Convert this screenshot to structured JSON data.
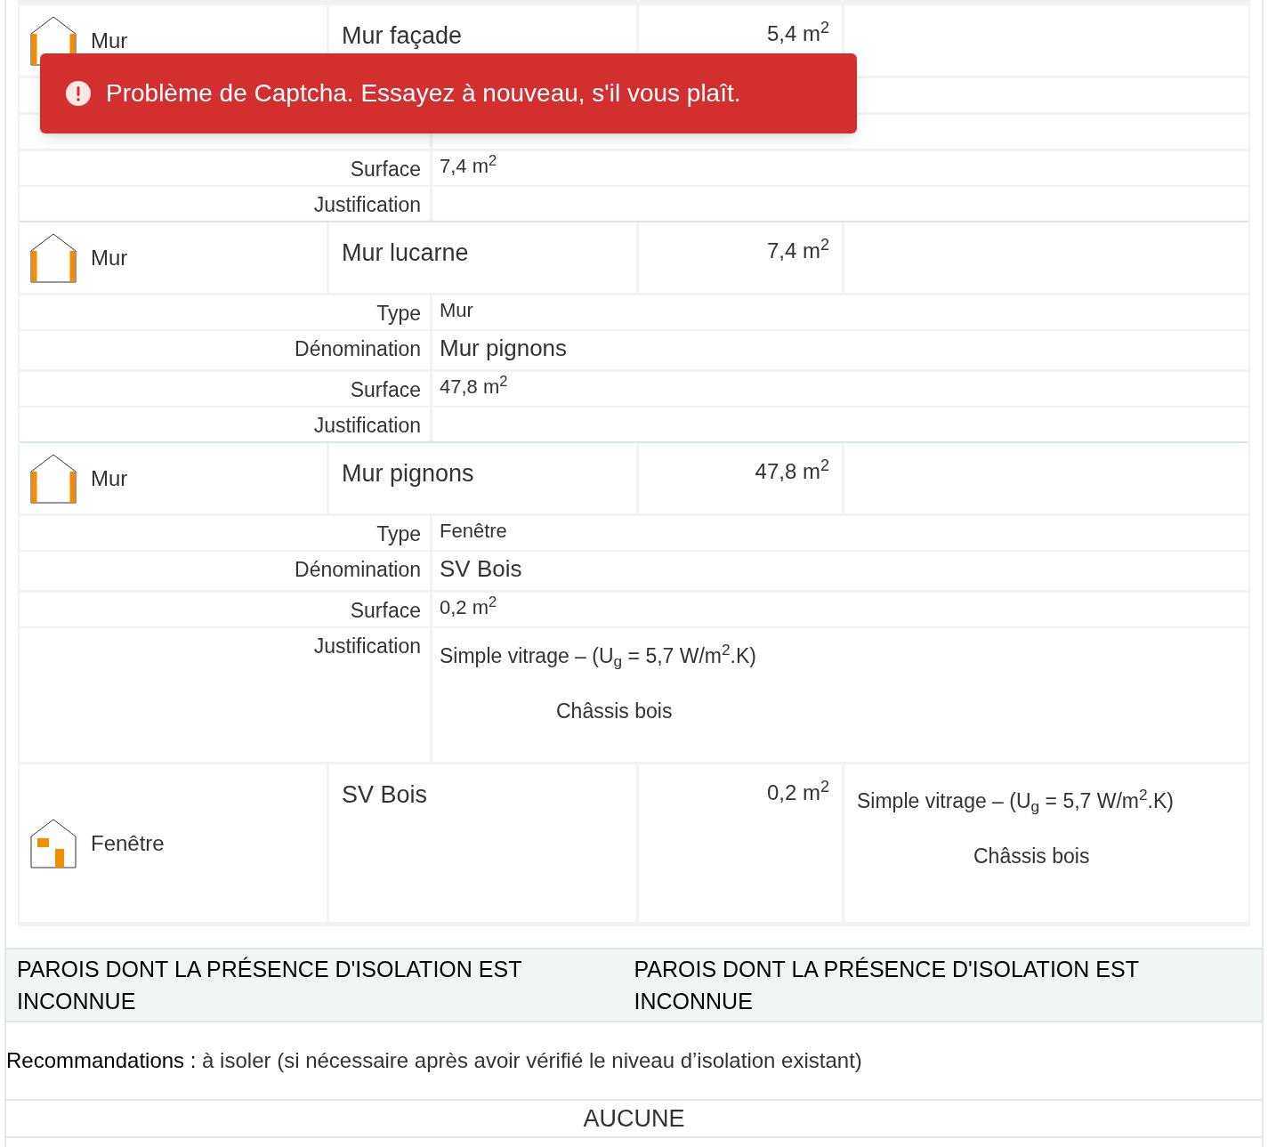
{
  "toast": {
    "message": "Problème de Captcha. Essayez à nouveau, s'il vous plaît."
  },
  "rows": [
    {
      "kind": "wall",
      "type": "Mur",
      "name": "Mur façade",
      "surface": "5,4 m$^{2}$"
    },
    {
      "kind": "blank"
    },
    {
      "kind": "blank"
    },
    {
      "kind": "detail",
      "label": "Surface",
      "value": "7,4 m$^{2}$"
    },
    {
      "kind": "end",
      "label": "Justification"
    },
    {
      "kind": "wall",
      "type": "Mur",
      "name": "Mur lucarne",
      "surface": "7,4 m$^{2}$"
    },
    {
      "kind": "detail",
      "label": "Type",
      "value": "Mur"
    },
    {
      "kind": "name",
      "label": "Dénomination",
      "value": "Mur pignons"
    },
    {
      "kind": "detail",
      "label": "Surface",
      "value": "47,8 m$^{2}$"
    },
    {
      "kind": "end",
      "label": "Justification"
    },
    {
      "kind": "wall",
      "type": "Mur",
      "name": "Mur pignons",
      "surface": "47,8 m$^{2}$"
    },
    {
      "kind": "detail",
      "label": "Type",
      "value": "Fenêtre"
    },
    {
      "kind": "name",
      "label": "Dénomination",
      "value": "SV Bois"
    },
    {
      "kind": "detail",
      "label": "Surface",
      "value": "0,2 m$^{2}$"
    },
    {
      "kind": "detail",
      "label": "Justification",
      "lines": [
        "Simple vitrage – (U$_{g}$ = 5,7 W/m$^{2}$.K)",
        "Châssis bois"
      ]
    },
    {
      "kind": "window",
      "type": "Fenêtre",
      "name": "SV Bois",
      "surface": "0,2 m$^{2}$",
      "lines": [
        "Simple vitrage – (U$_{g}$ = 5,7 W/m$^{2}$.K)",
        "Châssis bois"
      ]
    }
  ],
  "section": {
    "headings": [
      "PAROIS DONT LA PRÉSENCE D'ISOLATION EST INCONNUE",
      "PAROIS DONT LA PRÉSENCE D'ISOLATION EST INCONNUE"
    ],
    "recommendation": "**Recommandations :** à isoler (si nécessaire après avoir vérifié le niveau d’isolation existant)",
    "result": "AUCUNE"
  }
}
